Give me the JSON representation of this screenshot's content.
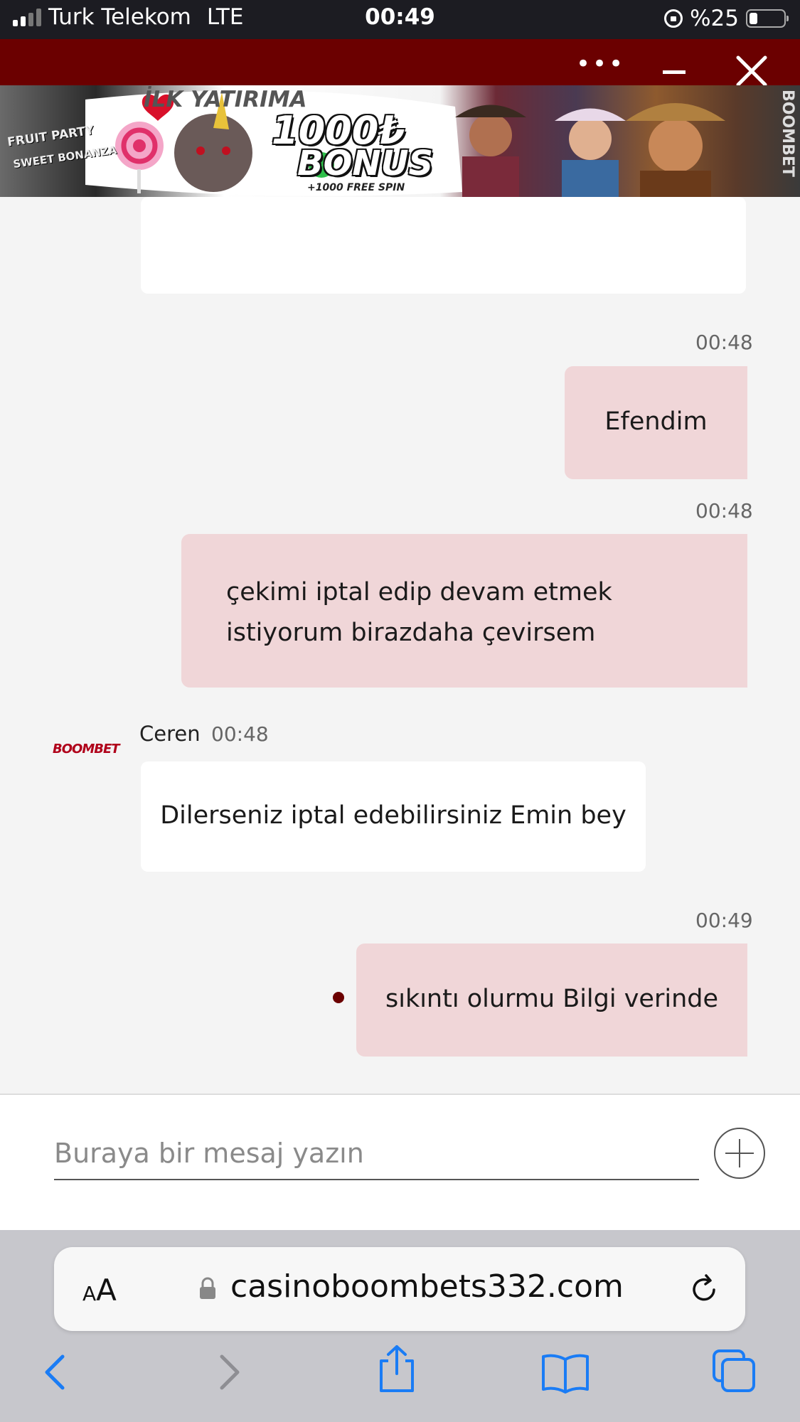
{
  "status_bar": {
    "carrier": "Turk Telekom",
    "network": "LTE",
    "time": "00:49",
    "battery": "%25"
  },
  "chat_header": {
    "more_label": "•••",
    "icons": [
      "more-icon",
      "minimize-icon",
      "close-icon"
    ]
  },
  "banner": {
    "top_text": "İLK YATIRIMA",
    "amount": "1000₺",
    "bonus": "BONUS",
    "spins": "+1000 FREE SPIN",
    "game1": "FRUIT PARTY",
    "game2": "SWEET BONANZA",
    "brand": "BOOMBET"
  },
  "messages": [
    {
      "time": "00:48",
      "text": "Efendim"
    },
    {
      "time": "00:48",
      "text": "çekimi iptal edip devam etmek istiyorum birazdaha çevirsem"
    },
    {
      "sender": "Ceren",
      "time": "00:48",
      "text": "Dilerseniz iptal edebilirsiniz Emin bey",
      "logo": "BOOMBET"
    },
    {
      "time": "00:49",
      "text": "sıkıntı olurmu Bilgi verinde"
    }
  ],
  "composer": {
    "placeholder": "Buraya bir mesaj yazın"
  },
  "safari": {
    "text_size_label": "AA",
    "url": "casinoboombets332.com",
    "toolbar_icons": [
      "back-icon",
      "forward-icon",
      "share-icon",
      "bookmarks-icon",
      "tabs-icon"
    ]
  },
  "colors": {
    "header_bg": "#6b0000",
    "user_bubble": "#f0d6d8",
    "agent_bubble": "#ffffff",
    "ios_blue": "#1a7cf5"
  }
}
